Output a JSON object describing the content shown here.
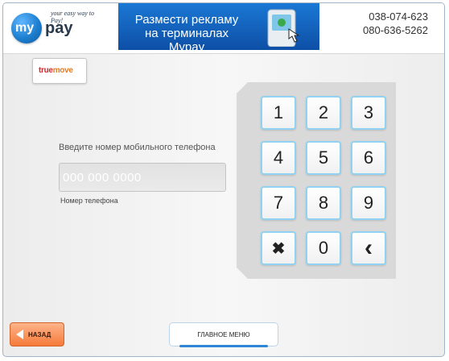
{
  "header": {
    "logo": {
      "word1": "my",
      "word2": "pay",
      "slogan": "your easy way to Pay!"
    },
    "banner": {
      "line1": "Размести рекламу",
      "line2": "на терминалах Mypay"
    },
    "phones": [
      "038-074-623",
      "080-636-5262"
    ]
  },
  "operator": {
    "name_part1": "true",
    "name_part2": "move"
  },
  "form": {
    "prompt": "Введите номер мобильного телефона",
    "placeholder": "000 000 0000",
    "label": "Номер телефона"
  },
  "keypad": {
    "keys": [
      "1",
      "2",
      "3",
      "4",
      "5",
      "6",
      "7",
      "8",
      "9",
      "✖",
      "0",
      "‹"
    ]
  },
  "footer": {
    "back_label": "НАЗАД",
    "main_menu_label": "ГЛАВНОЕ МЕНЮ"
  },
  "colors": {
    "accent": "#1e7fd0",
    "key_border": "#8fd2f2",
    "back_button": "#f57a3a"
  }
}
